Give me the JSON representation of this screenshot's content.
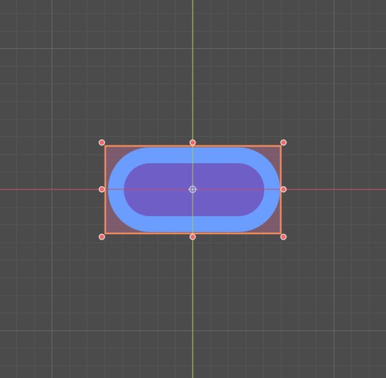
{
  "editor": {
    "background_color": "#4b4b4b",
    "minor_grid_color": "#555555",
    "major_grid_color": "#666666",
    "x_axis_color": "#c24a63",
    "y_axis_color": "#a6cc4a",
    "selection_color": "#f08a5d",
    "handle_color": "#f06a6a"
  },
  "selected_node": {
    "shape": "capsule",
    "fill_color": "#6b9cff",
    "inner_color": "#6e5ec6",
    "overlay_color": "#a56a8a",
    "pivot_icon": "pivot-crosshair-icon",
    "resize_handles": [
      "top-left",
      "top",
      "top-right",
      "right",
      "bottom-right",
      "bottom",
      "bottom-left",
      "left"
    ]
  }
}
